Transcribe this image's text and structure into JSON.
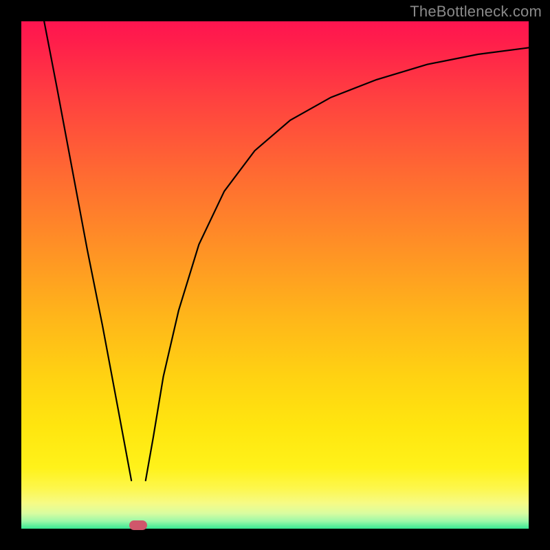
{
  "watermark": "TheBottleneck.com",
  "chart_data": {
    "type": "line",
    "title": "",
    "xlabel": "",
    "ylabel": "",
    "xlim": [
      0,
      100
    ],
    "ylim": [
      0,
      100
    ],
    "grid": false,
    "legend": false,
    "series": [
      {
        "name": "left-branch",
        "x": [
          4.5,
          7,
          10,
          13,
          16,
          19,
          21.7
        ],
        "values": [
          100,
          87,
          71,
          55,
          40,
          24,
          9.5
        ],
        "style": "line"
      },
      {
        "name": "right-branch",
        "x": [
          24.5,
          26,
          28,
          31,
          35,
          40,
          46,
          53,
          61,
          70,
          80,
          90,
          100
        ],
        "values": [
          9.5,
          18,
          30,
          43,
          56,
          66.5,
          74.5,
          80.5,
          85,
          88.5,
          91.5,
          93.5,
          94.8
        ],
        "style": "line"
      }
    ],
    "markers": [
      {
        "name": "vertex-marker",
        "x": 23,
        "y": 0.7,
        "color": "#d0576b"
      }
    ],
    "background_gradient": {
      "top": "#ff1450",
      "mid_upper": "#ff9225",
      "mid": "#ffe60f",
      "bottom": "#37e893"
    }
  }
}
